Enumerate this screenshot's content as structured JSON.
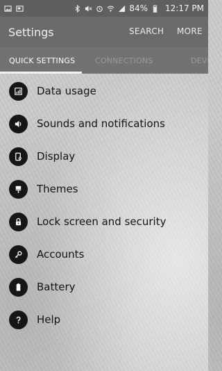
{
  "status_bar": {
    "battery_percent": "84%",
    "time": "12:17 PM"
  },
  "action_bar": {
    "title": "Settings",
    "search_label": "SEARCH",
    "more_label": "MORE"
  },
  "tabs": [
    {
      "label": "QUICK SETTINGS",
      "selected": true
    },
    {
      "label": "CONNECTIONS",
      "selected": false
    },
    {
      "label": "DEVI",
      "selected": false
    }
  ],
  "settings_items": [
    {
      "label": "Data usage",
      "icon": "data-usage-icon"
    },
    {
      "label": "Sounds and notifications",
      "icon": "volume-icon"
    },
    {
      "label": "Display",
      "icon": "display-icon"
    },
    {
      "label": "Themes",
      "icon": "themes-brush-icon"
    },
    {
      "label": "Lock screen and security",
      "icon": "lock-icon"
    },
    {
      "label": "Accounts",
      "icon": "key-icon"
    },
    {
      "label": "Battery",
      "icon": "battery-icon"
    },
    {
      "label": "Help",
      "icon": "help-icon"
    }
  ],
  "colors": {
    "status_bar_bg": "#5f5f5f",
    "action_bar_bg": "#6a6a6a",
    "tab_bar_bg": "#727272",
    "icon_circle": "#161616",
    "text_primary": "#151515"
  }
}
